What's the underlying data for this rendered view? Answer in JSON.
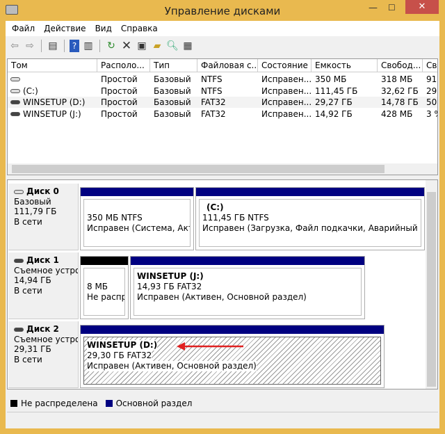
{
  "window": {
    "title": "Управление дисками",
    "close": "✕",
    "minimize": "—",
    "maximize": "☐"
  },
  "menu": [
    "Файл",
    "Действие",
    "Вид",
    "Справка"
  ],
  "toolbar": [
    "back-icon",
    "forward-icon",
    "console-tree-icon",
    "help-icon",
    "action-pane-icon",
    "refresh-icon",
    "delete-icon",
    "properties-icon",
    "open-icon",
    "search-icon",
    "settings-icon"
  ],
  "list": {
    "columns": [
      "Том",
      "Располо...",
      "Тип",
      "Файловая с...",
      "Состояние",
      "Емкость",
      "Свобод...",
      "Св"
    ],
    "rows": [
      [
        "",
        "Простой",
        "Базовый",
        "NTFS",
        "Исправен...",
        "350 МБ",
        "318 МБ",
        "91"
      ],
      [
        "(C:)",
        "Простой",
        "Базовый",
        "NTFS",
        "Исправен...",
        "111,45 ГБ",
        "32,62 ГБ",
        "29"
      ],
      [
        "WINSETUP (D:)",
        "Простой",
        "Базовый",
        "FAT32",
        "Исправен...",
        "29,27 ГБ",
        "14,78 ГБ",
        "50"
      ],
      [
        "WINSETUP (J:)",
        "Простой",
        "Базовый",
        "FAT32",
        "Исправен...",
        "14,92 ГБ",
        "428 МБ",
        "3 %"
      ]
    ]
  },
  "disks": [
    {
      "name": "Диск 0",
      "type": "Базовый",
      "size": "111,79 ГБ",
      "status": "В сети",
      "partitions": [
        {
          "title": "",
          "size": "350 МБ NTFS",
          "state": "Исправен (Система, Активе"
        },
        {
          "title": "(C:)",
          "size": "111,45 ГБ NTFS",
          "state": "Исправен (Загрузка, Файл подкачки, Аварийный дамп па"
        }
      ]
    },
    {
      "name": "Диск 1",
      "type": "Съемное устрои",
      "size": "14,94 ГБ",
      "status": "В сети",
      "partitions": [
        {
          "title": "",
          "size": "8 МБ",
          "state": "Не распре"
        },
        {
          "title": "WINSETUP  (J:)",
          "size": "14,93 ГБ FAT32",
          "state": "Исправен (Активен, Основной раздел)"
        }
      ]
    },
    {
      "name": "Диск 2",
      "type": "Съемное устрои",
      "size": "29,31 ГБ",
      "status": "В сети",
      "partitions": [
        {
          "title": "WINSETUP  (D:)",
          "size": "29,30 ГБ FAT32",
          "state": "Исправен (Активен, Основной раздел)"
        }
      ]
    }
  ],
  "legend": [
    {
      "label": "Не распределена",
      "color": "#000000"
    },
    {
      "label": "Основной раздел",
      "color": "#000080"
    }
  ]
}
